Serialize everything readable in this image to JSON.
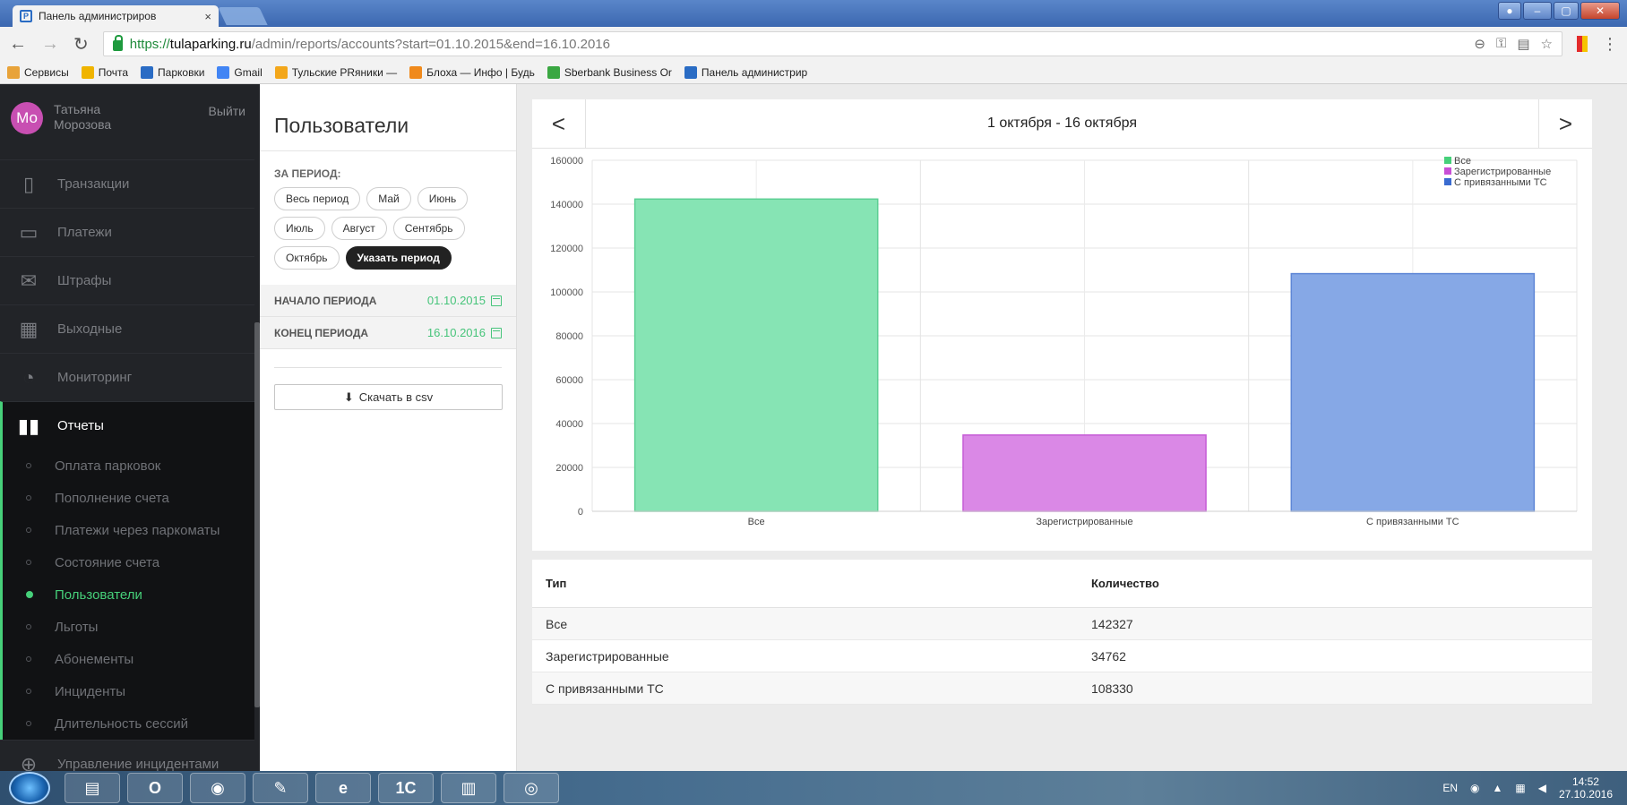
{
  "browser": {
    "tab_title": "Панель администриров",
    "tab_close": "×",
    "favicon_letter": "P",
    "url_scheme": "https://",
    "url_host": "tulaparking.ru",
    "url_path": "/admin/reports/accounts?start=01.10.2015&end=16.10.2016",
    "bookmarks": [
      {
        "label": "Сервисы",
        "color": "#e8a33a"
      },
      {
        "label": "Почта",
        "color": "#f0b400"
      },
      {
        "label": "Парковки",
        "color": "#2a6cc4"
      },
      {
        "label": "Gmail",
        "color": "#4285f4"
      },
      {
        "label": "Тульские PRяники —",
        "color": "#f3a71b"
      },
      {
        "label": "Блоха — Инфо | Будь",
        "color": "#f08a1c"
      },
      {
        "label": "Sberbank Business Or",
        "color": "#3aa742"
      },
      {
        "label": "Панель администрир",
        "color": "#2a6cc4"
      }
    ]
  },
  "sidebar": {
    "avatar_initials": "Мо",
    "user_name": "Татьяна Морозова",
    "logout": "Выйти",
    "menu": [
      {
        "label": "Транзакции",
        "icon": "notebook-icon"
      },
      {
        "label": "Платежи",
        "icon": "card-icon"
      },
      {
        "label": "Штрафы",
        "icon": "envelope-icon"
      },
      {
        "label": "Выходные",
        "icon": "calendar-icon"
      },
      {
        "label": "Мониторинг",
        "icon": "gauge-icon"
      }
    ],
    "active_menu": {
      "label": "Отчеты",
      "icon": "bar-chart-icon"
    },
    "submenu": [
      {
        "label": "Оплата парковок"
      },
      {
        "label": "Пополнение счета"
      },
      {
        "label": "Платежи через паркоматы"
      },
      {
        "label": "Состояние счета"
      },
      {
        "label": "Пользователи",
        "active": true
      },
      {
        "label": "Льготы"
      },
      {
        "label": "Абонементы"
      },
      {
        "label": "Инциденты"
      },
      {
        "label": "Длительность сессий"
      }
    ],
    "bottom_menu": {
      "label": "Управление инцидентами",
      "icon": "lifebuoy-icon"
    }
  },
  "filter": {
    "title": "Пользователи",
    "period_label": "ЗА ПЕРИОД:",
    "chips": [
      "Весь период",
      "Май",
      "Июнь",
      "Июль",
      "Август",
      "Сентябрь",
      "Октябрь",
      "Указать период"
    ],
    "active_chip": "Указать период",
    "start_label": "НАЧАЛО ПЕРИОДА",
    "start_value": "01.10.2015",
    "end_label": "КОНЕЦ ПЕРИОДА",
    "end_value": "16.10.2016",
    "download_label": "Скачать в csv"
  },
  "main": {
    "period_range": "1 октября - 16 октября",
    "prev": "<",
    "next": ">"
  },
  "chart_data": {
    "type": "bar",
    "categories": [
      "Все",
      "Зарегистрированные",
      "С привязанными ТС"
    ],
    "values": [
      142327,
      34762,
      108330
    ],
    "colors": [
      "#86e4b4",
      "#da88e6",
      "#86a8e6"
    ],
    "edge_colors": [
      "#5ccf93",
      "#c55ad6",
      "#5e86d6"
    ],
    "legend_colors": [
      "#46d07a",
      "#c84fd6",
      "#3a6bd0"
    ],
    "legend": [
      "Все",
      "Зарегистрированные",
      "С привязанными ТС"
    ],
    "legend_position": "top-right",
    "ylim": [
      0,
      160000
    ],
    "yticks": [
      0,
      20000,
      40000,
      60000,
      80000,
      100000,
      120000,
      140000,
      160000
    ],
    "grid": true
  },
  "table": {
    "headers": [
      "Тип",
      "Количество"
    ],
    "rows": [
      [
        "Все",
        "142327"
      ],
      [
        "Зарегистрированные",
        "34762"
      ],
      [
        "С привязанными ТС",
        "108330"
      ]
    ]
  },
  "taskbar": {
    "lang": "EN",
    "time": "14:52",
    "date": "27.10.2016",
    "items": [
      "folder-icon",
      "opera-icon",
      "chrome-icon",
      "paint-icon",
      "ie-icon",
      "1c-icon",
      "winrar-icon",
      "camera-icon"
    ]
  }
}
